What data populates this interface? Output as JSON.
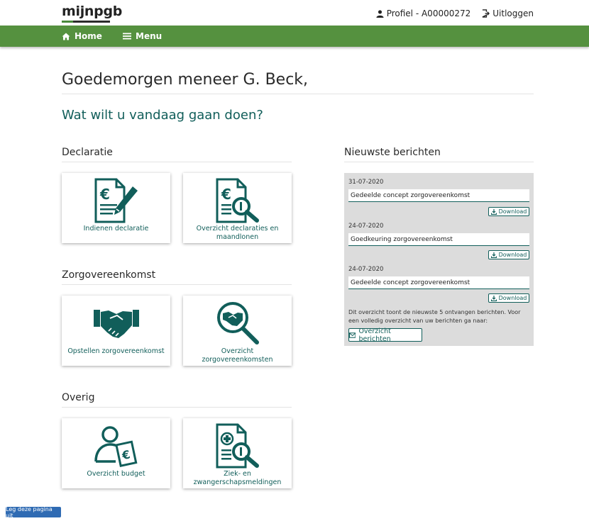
{
  "logo": {
    "text": "mijnpgb"
  },
  "header": {
    "profile_label": "Profiel - A00000272",
    "logout_label": "Uitloggen"
  },
  "nav": {
    "home": "Home",
    "menu": "Menu"
  },
  "greeting": "Goedemorgen meneer G. Beck,",
  "question": "Wat wilt u vandaag gaan doen?",
  "sections": {
    "declaratie": {
      "title": "Declaratie",
      "tiles": [
        {
          "label": "Indienen declaratie",
          "icon": "euro-document-pen-icon"
        },
        {
          "label": "Overzicht declaraties en maandlonen",
          "icon": "euro-document-search-icon"
        }
      ]
    },
    "zorgovereenkomst": {
      "title": "Zorgovereenkomst",
      "tiles": [
        {
          "label": "Opstellen zorgovereenkomst",
          "icon": "handshake-icon"
        },
        {
          "label": "Overzicht zorgovereenkomsten",
          "icon": "handshake-search-icon"
        }
      ]
    },
    "overig": {
      "title": "Overig",
      "tiles": [
        {
          "label": "Overzicht budget",
          "icon": "person-euro-icon"
        },
        {
          "label": "Ziek- en zwangerschapsmeldingen",
          "icon": "medical-document-search-icon"
        }
      ]
    }
  },
  "messages": {
    "title": "Nieuwste berichten",
    "items": [
      {
        "date": "31-07-2020",
        "subject": "Gedeelde concept zorgovereenkomst",
        "download": "Download"
      },
      {
        "date": "24-07-2020",
        "subject": "Goedkeuring zorgovereenkomst",
        "download": "Download"
      },
      {
        "date": "24-07-2020",
        "subject": "Gedeelde concept zorgovereenkomst",
        "download": "Download"
      }
    ],
    "note": "Dit overzicht toont de nieuwste 5 ontvangen berichten. Voor een volledig overzicht van uw berichten ga naar:",
    "overview_button": "Overzicht berichten"
  },
  "feedback_button": "Leg deze pagina uit",
  "colors": {
    "brand_green": "#55913f",
    "teal": "#115e5a",
    "feedback_blue": "#2f6bb3"
  }
}
